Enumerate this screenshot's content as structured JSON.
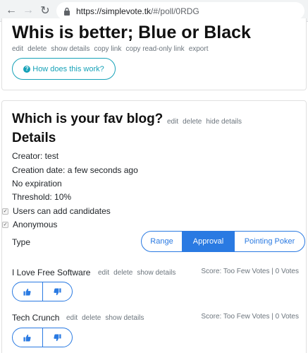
{
  "browser": {
    "url_host": "https://simplevote.tk",
    "url_path": "/#/poll/0RDG"
  },
  "poll": {
    "title": "Whis is better; Blue or Black",
    "actions": [
      "edit",
      "delete",
      "show details",
      "copy link",
      "copy read-only link",
      "export"
    ],
    "how_button": "How does this work?"
  },
  "question": {
    "title": "Which is your fav blog?",
    "actions": [
      "edit",
      "delete",
      "hide details"
    ],
    "details_heading": "Details",
    "creator": "Creator: test",
    "creation_date": "Creation date: a few seconds ago",
    "expiration": "No expiration",
    "threshold": "Threshold: 10%",
    "users_add": "Users can add candidates",
    "anonymous": "Anonymous",
    "type_label": "Type",
    "type_options": [
      "Range",
      "Approval",
      "Pointing Poker"
    ],
    "type_selected": "Approval"
  },
  "candidates": [
    {
      "name": "I Love Free Software",
      "actions": [
        "edit",
        "delete",
        "show details"
      ],
      "score": "Score: Too Few Votes | 0 Votes"
    },
    {
      "name": "Tech Crunch",
      "actions": [
        "edit",
        "delete",
        "show details"
      ],
      "score": "Score: Too Few Votes | 0 Votes"
    }
  ],
  "icons": {
    "upvote": "thumbs-up-icon",
    "downvote": "thumbs-down-icon",
    "help": "question-circle-icon"
  },
  "colors": {
    "accent": "#2a7ae2",
    "info": "#17a2b8",
    "muted": "#6c757d"
  }
}
